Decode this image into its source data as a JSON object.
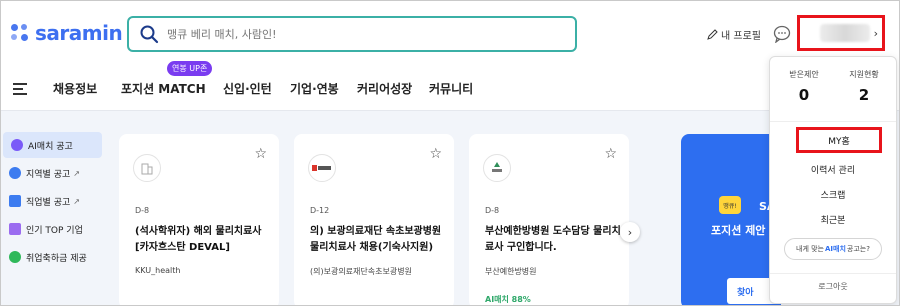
{
  "brand": {
    "name": "saramin"
  },
  "search": {
    "placeholder": "맹큐 베리 매치, 사람인!"
  },
  "header": {
    "profile_label": "내 프로필"
  },
  "nav": {
    "items": [
      "채용정보",
      "포지션 MATCH",
      "신입·인턴",
      "기업·연봉",
      "커리어성장",
      "커뮤니티"
    ],
    "badge": "연봉 UP존"
  },
  "left_menu": [
    {
      "label": "AI매치 공고",
      "icon": "sparkle-icon",
      "color": "#7a5af8",
      "arrow": ""
    },
    {
      "label": "지역별 공고",
      "icon": "location-pin-icon",
      "color": "#3d7cf0",
      "arrow": "↗"
    },
    {
      "label": "직업별 공고",
      "icon": "briefcase-icon",
      "color": "#3d7cf0",
      "arrow": "↗"
    },
    {
      "label": "인기 TOP 기업",
      "icon": "crown-icon",
      "color": "#9b6cf0",
      "arrow": ""
    },
    {
      "label": "취업축하금 제공",
      "icon": "coin-icon",
      "color": "#2fb85a",
      "arrow": ""
    }
  ],
  "cards": [
    {
      "dday": "D-8",
      "title": "(석사학위자) 해외 물리치료사 [카자흐스탄 DEVAL]",
      "company": "KKU_health",
      "logo": "building-icon",
      "match": ""
    },
    {
      "dday": "D-12",
      "title": "의) 보광의료재단 속초보광병원 물리치료사 채용(기숙사지원)",
      "company": "(의)보광의료재단속초보광병원",
      "logo": "hospital-logo",
      "match": ""
    },
    {
      "dday": "D-8",
      "title": "부산예한방병원 도수담당 물리치료사 구인합니다.",
      "company": "부산예한방병원",
      "logo": "clinic-logo",
      "match": "AI매치 88%"
    }
  ],
  "promo": {
    "badge": "땡큐!",
    "partial_brand": "SA",
    "text": "포지션 제안",
    "button": "찾아"
  },
  "dropdown": {
    "stats": [
      {
        "label": "받은제안",
        "value": "0"
      },
      {
        "label": "지원현황",
        "value": "2"
      }
    ],
    "items": [
      "MY홈",
      "이력서 관리",
      "스크랩",
      "최근본"
    ],
    "pill_prefix": "내게 맞는 ",
    "pill_highlight": "AI매치",
    "pill_suffix": " 공고는?",
    "logout": "로그아웃"
  }
}
